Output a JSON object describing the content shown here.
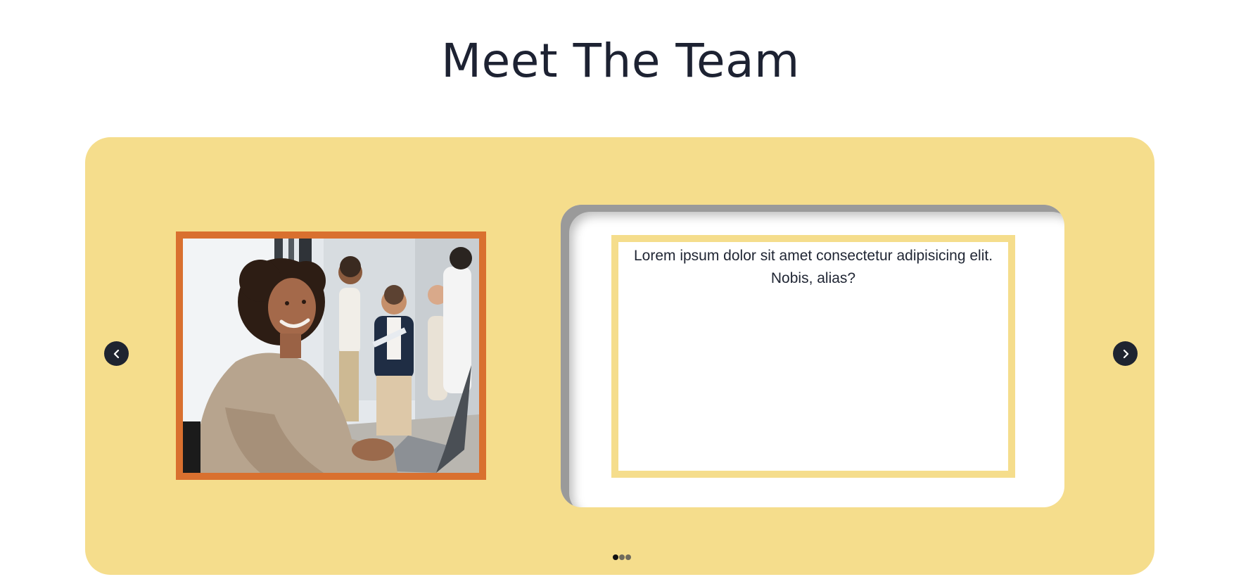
{
  "page": {
    "title": "Meet The Team"
  },
  "carousel": {
    "background_color": "#f5dd8c",
    "prev_icon": "chevron-left-icon",
    "next_icon": "chevron-right-icon",
    "slide": {
      "photo_frame_color": "#d9702f",
      "photo_description": "team-member-photo",
      "text": "Lorem ipsum dolor sit amet consectetur adipisicing elit. Nobis, alias?"
    },
    "pagination": {
      "total": 3,
      "active_index": 0
    }
  }
}
